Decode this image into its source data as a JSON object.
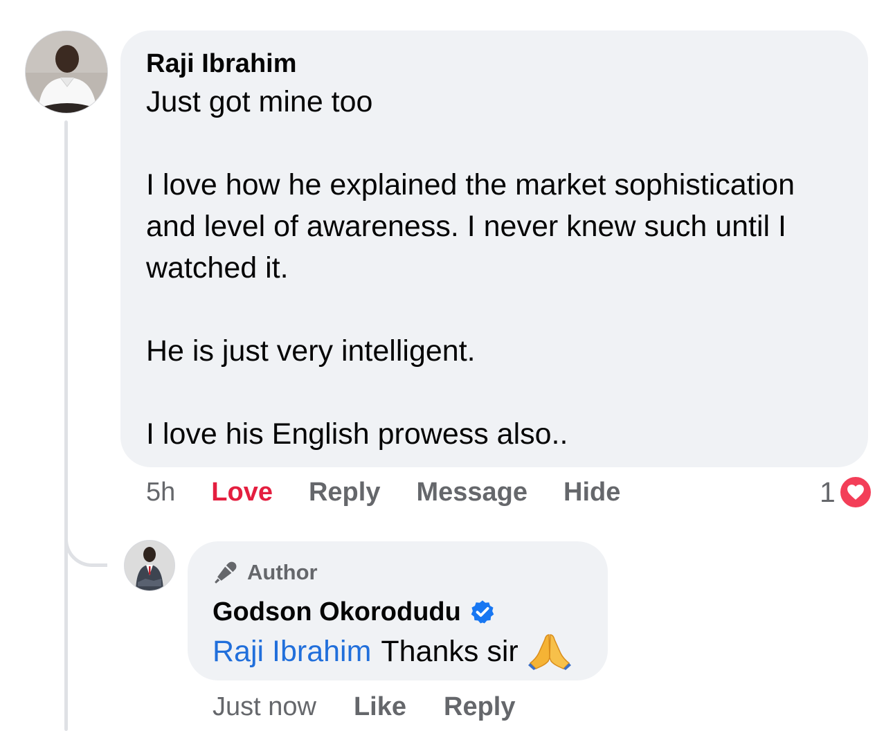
{
  "comment": {
    "author": "Raji Ibrahim",
    "text": "Just got mine too\n\nI love how he explained the market sophistication and level of awareness. I never knew such until I watched it.\n\nHe is just very intelligent.\n\nI love his English prowess also..",
    "time": "5h",
    "actions": {
      "love": "Love",
      "reply": "Reply",
      "message": "Message",
      "hide": "Hide"
    },
    "reaction_count": "1",
    "reaction_icon": "heart-icon",
    "love_color": "#e41e3f"
  },
  "reply": {
    "badge_label": "Author",
    "badge_icon": "microphone-icon",
    "author": "Godson Okorodudu",
    "verified_icon": "verified-badge-icon",
    "mention": "Raji Ibrahim",
    "text": "Thanks sir",
    "emoji": "folded-hands-icon",
    "time": "Just now",
    "actions": {
      "like": "Like",
      "reply": "Reply"
    },
    "mention_color": "#216fdb"
  }
}
